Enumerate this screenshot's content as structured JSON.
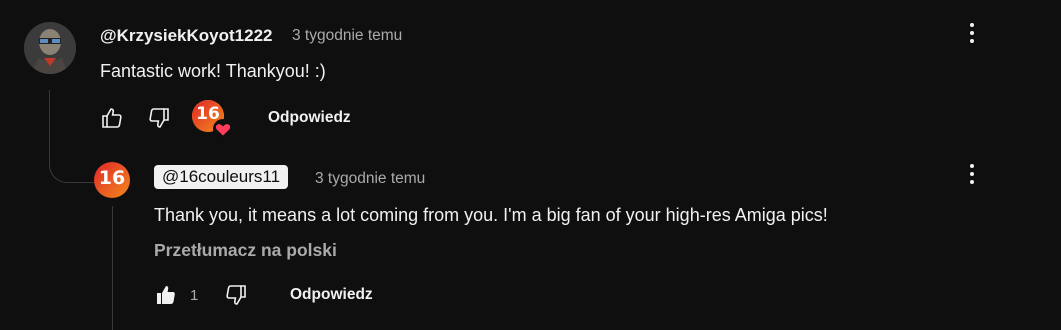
{
  "comment": {
    "author": "@KrzysiekKoyot1222",
    "time": "3 tygodnie temu",
    "text": "Fantastic work! Thankyou! :)",
    "reply_label": "Odpowiedz",
    "creator_badge_text": "16"
  },
  "reply": {
    "author": "@16couleurs11",
    "time": "3 tygodnie temu",
    "text": "Thank you, it means a lot coming from you. I'm a big fan of your high-res Amiga pics!",
    "translate_label": "Przetłumacz na polski",
    "like_count": "1",
    "reply_label": "Odpowiedz",
    "avatar_text": "16"
  },
  "icons": [
    "thumb-up-icon",
    "thumb-down-icon",
    "kebab-menu-icon",
    "heart-icon"
  ],
  "colors": {
    "background": "#0f0f0f",
    "text": "#f1f1f1",
    "muted": "#aaaaaa",
    "heart": "#ff3d5b",
    "logo_red": "#e0262a"
  }
}
